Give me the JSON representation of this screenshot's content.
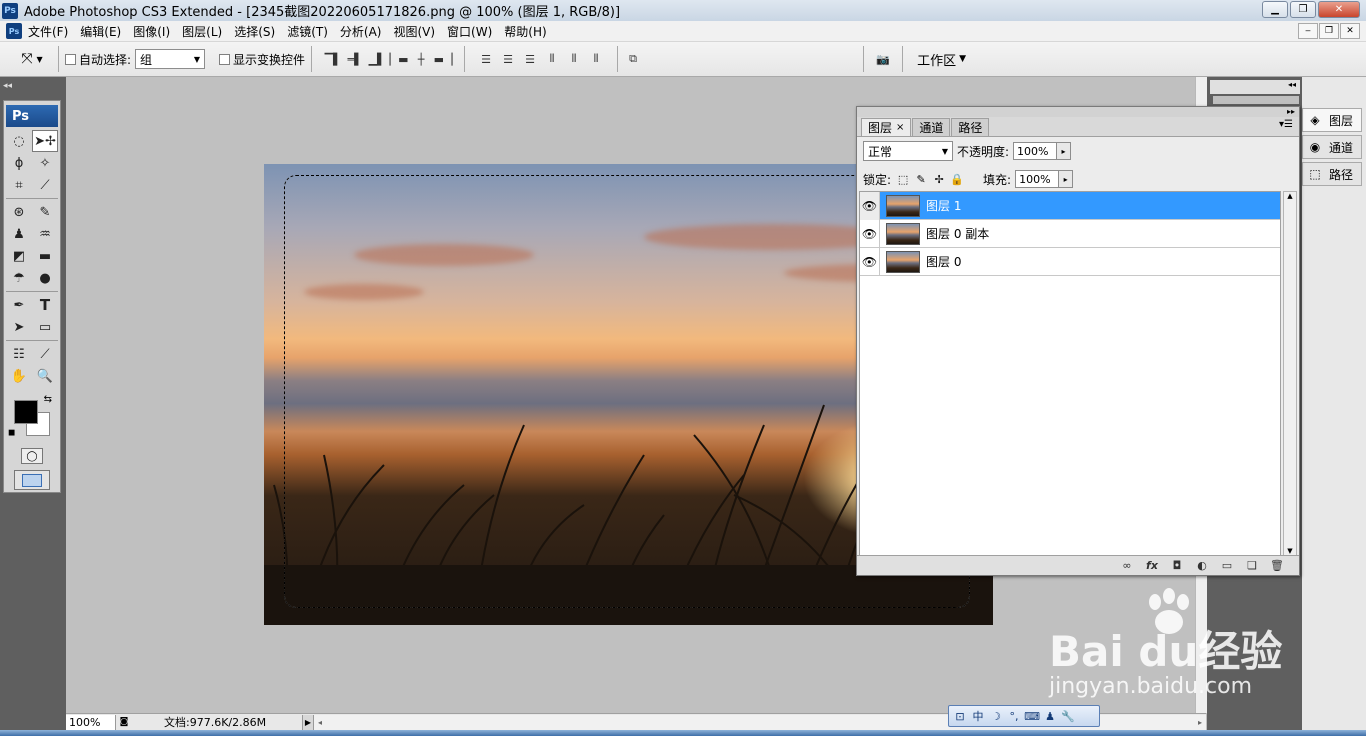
{
  "window": {
    "app_icon": "Ps",
    "title": "Adobe Photoshop CS3 Extended - [2345截图20220605171826.png @ 100% (图层 1, RGB/8)]",
    "minimize_glyph": "▁",
    "maximize_glyph": "❐",
    "close_glyph": "✕"
  },
  "menubar": {
    "app_icon": "Ps",
    "items": [
      "文件(F)",
      "编辑(E)",
      "图像(I)",
      "图层(L)",
      "选择(S)",
      "滤镜(T)",
      "分析(A)",
      "视图(V)",
      "窗口(W)",
      "帮助(H)"
    ],
    "doc_min": "‒",
    "doc_restore": "❐",
    "doc_close": "✕"
  },
  "options": {
    "tool_icon": "move-tool-icon",
    "auto_select_label": "自动选择:",
    "auto_select_value": "组",
    "show_transform_label": "显示变换控件",
    "workspace_label": "工作区"
  },
  "toolbox": {
    "badge": "Ps",
    "collapse": "◂◂"
  },
  "canvas": {
    "photo_description_icon": "sunset-photo"
  },
  "status": {
    "zoom": "100%",
    "doc_info": "文档:977.6K/2.86M"
  },
  "dock": {
    "collapse": "◂◂",
    "buttons": [
      {
        "label": "图层",
        "icon": "layers-icon"
      },
      {
        "label": "通道",
        "icon": "channels-icon"
      },
      {
        "label": "路径",
        "icon": "paths-icon"
      }
    ]
  },
  "layers_panel": {
    "collapse": "▸▸",
    "tabs": [
      "图层",
      "通道",
      "路径"
    ],
    "tab_close": "×",
    "blend_mode": "正常",
    "opacity_label": "不透明度:",
    "opacity_value": "100%",
    "lock_label": "锁定:",
    "fill_label": "填充:",
    "fill_value": "100%",
    "layers": [
      {
        "name": "图层 1",
        "selected": true
      },
      {
        "name": "图层 0 副本",
        "selected": false
      },
      {
        "name": "图层 0",
        "selected": false
      }
    ]
  },
  "ime": {
    "lang": "中"
  },
  "watermark": {
    "brand": "Bai du经验",
    "url": "jingyan.baidu.com"
  },
  "colors": {
    "selection_blue": "#3399ff",
    "ps_blue": "#1b4a8a"
  }
}
